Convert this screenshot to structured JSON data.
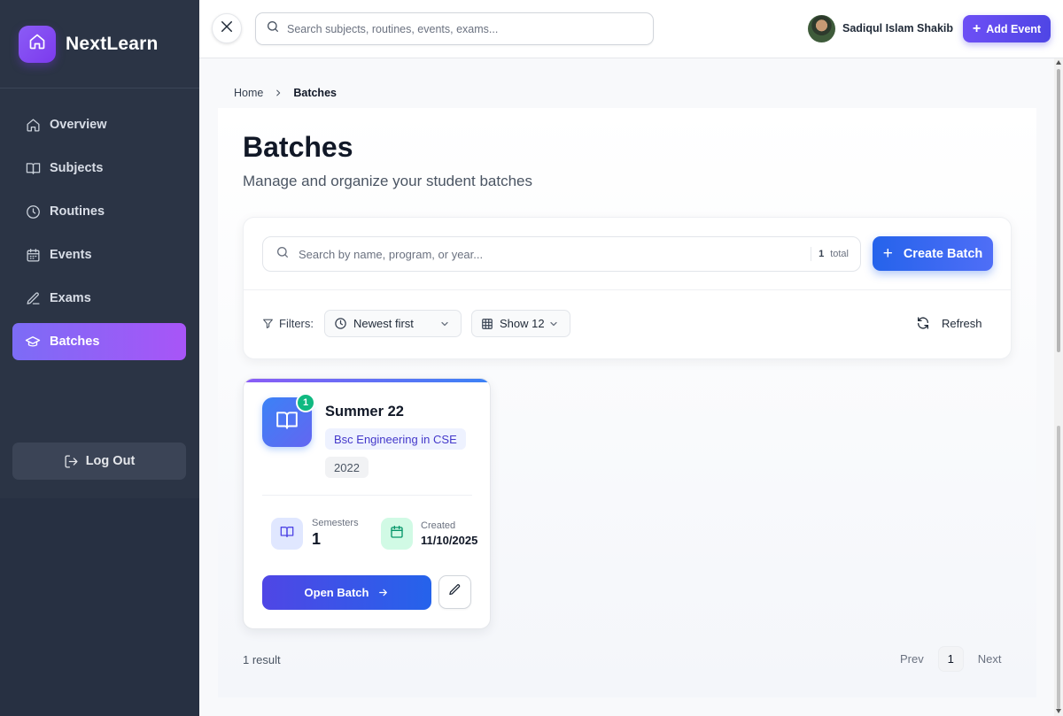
{
  "app": {
    "brand": "NextLearn",
    "logo_icon": "home-icon"
  },
  "sidebar": {
    "items": [
      {
        "label": "Overview",
        "icon": "home-icon",
        "active": false
      },
      {
        "label": "Subjects",
        "icon": "book-icon",
        "active": false
      },
      {
        "label": "Routines",
        "icon": "clock-icon",
        "active": false
      },
      {
        "label": "Events",
        "icon": "calendar-icon",
        "active": false
      },
      {
        "label": "Exams",
        "icon": "pen-icon",
        "active": false
      },
      {
        "label": "Batches",
        "icon": "graduation-cap-icon",
        "active": true
      }
    ],
    "logout_label": "Log Out"
  },
  "topbar": {
    "search_placeholder": "Search subjects, routines, events, exams...",
    "user_name": "Sadiqul Islam Shakib",
    "add_event_label": "Add Event"
  },
  "breadcrumb": {
    "home": "Home",
    "current": "Batches"
  },
  "page": {
    "title": "Batches",
    "subtitle": "Manage and organize your student batches"
  },
  "toolbar": {
    "search_placeholder": "Search by name, program, or year...",
    "total_count": "1",
    "total_label": "total",
    "create_label": "Create Batch",
    "filters_label": "Filters:",
    "sort_value": "Newest first",
    "show_value": "Show 12",
    "refresh_label": "Refresh"
  },
  "batches": [
    {
      "name": "Summer 22",
      "badge": "1",
      "program": "Bsc Engineering in CSE",
      "year": "2022",
      "semesters_label": "Semesters",
      "semesters_value": "1",
      "created_label": "Created",
      "created_value": "11/10/2025",
      "open_label": "Open Batch"
    }
  ],
  "footer": {
    "result_text": "1 result",
    "prev_label": "Prev",
    "current_page": "1",
    "next_label": "Next"
  },
  "colors": {
    "sidebar_bg": "#2b3445",
    "accent_purple": "#7c6cf6",
    "accent_blue": "#2563eb",
    "badge_green": "#10b981"
  }
}
